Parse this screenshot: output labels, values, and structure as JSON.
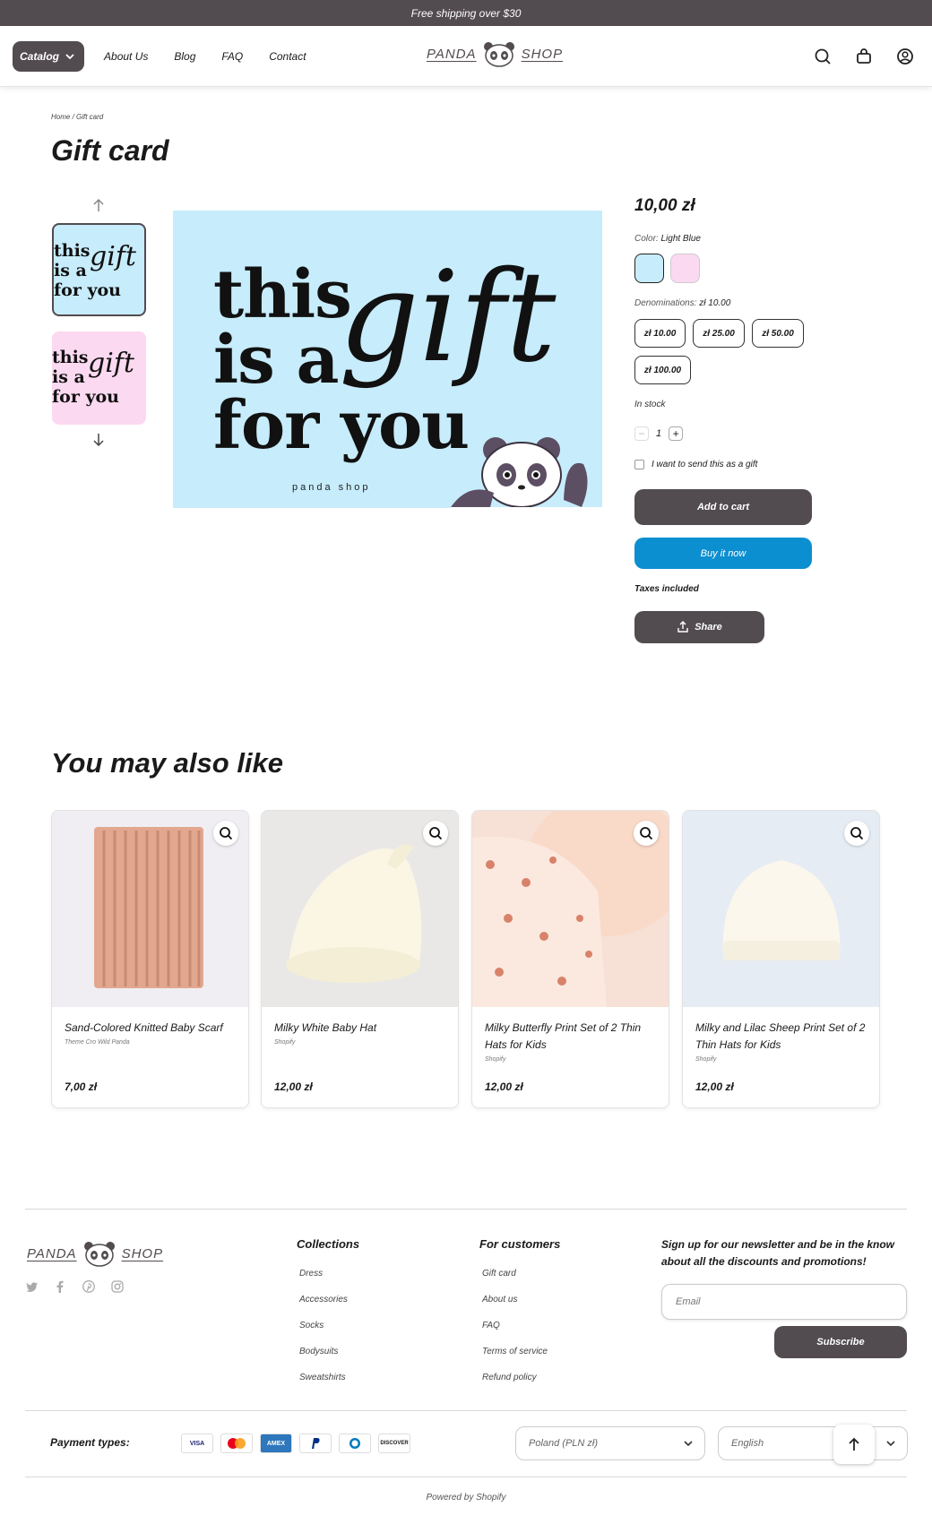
{
  "announcement": "Free shipping over $30",
  "header": {
    "catalog_label": "Catalog",
    "nav": [
      "About Us",
      "Blog",
      "FAQ",
      "Contact"
    ],
    "logo_left": "PANDA",
    "logo_right": "SHOP"
  },
  "breadcrumb": "Home / Gift card",
  "product": {
    "title": "Gift card",
    "price": "10,00 zł",
    "color_label": "Color:",
    "color_value": "Light Blue",
    "swatch_colors": [
      "#c7ecfb",
      "#fbd9f0"
    ],
    "denom_label": "Denominations:",
    "denom_value": "zł 10.00",
    "denominations": [
      "zł 10.00",
      "zł 25.00",
      "zł 50.00",
      "zł 100.00"
    ],
    "stock": "In stock",
    "qty_minus": "−",
    "quantity": "1",
    "qty_plus": "+",
    "gift_label": "I want to send this as a gift",
    "add_to_cart": "Add to cart",
    "buy_now": "Buy it now",
    "taxes": "Taxes included",
    "share": "Share",
    "image_text": [
      "this",
      "is a",
      "for you"
    ],
    "image_script": "gift",
    "image_sub": "panda shop"
  },
  "related": {
    "title": "You may also like",
    "items": [
      {
        "name": "Sand-Colored Knitted Baby Scarf",
        "vendor": "Theme Cro Wild Panda",
        "price": "7,00 zł"
      },
      {
        "name": "Milky White Baby Hat",
        "vendor": "Shopify",
        "price": "12,00 zł"
      },
      {
        "name": "Milky Butterfly Print Set of 2 Thin Hats for Kids",
        "vendor": "Shopify",
        "price": "12,00 zł"
      },
      {
        "name": "Milky and Lilac Sheep Print Set of 2 Thin Hats for Kids",
        "vendor": "Shopify",
        "price": "12,00 zł"
      }
    ]
  },
  "footer": {
    "collections_title": "Collections",
    "collections": [
      "Dress",
      "Accessories",
      "Socks",
      "Bodysuits",
      "Sweatshirts"
    ],
    "customers_title": "For customers",
    "customers": [
      "Gift card",
      "About us",
      "FAQ",
      "Terms of service",
      "Refund policy"
    ],
    "newsletter": "Sign up for our newsletter and be in the know about all the discounts and promotions!",
    "email_placeholder": "Email",
    "subscribe": "Subscribe",
    "payment_label": "Payment types:",
    "payments": [
      "VISA",
      "MC",
      "AMEX",
      "PayPal",
      "Diners",
      "DISCOVER"
    ],
    "country": "Poland (PLN zł)",
    "language": "English",
    "powered": "Powered by Shopify"
  },
  "colors": {
    "brand": "#524b50",
    "buy": "#0c8fd0",
    "light_blue": "#c7ecfb",
    "pink": "#fbd9f0"
  }
}
